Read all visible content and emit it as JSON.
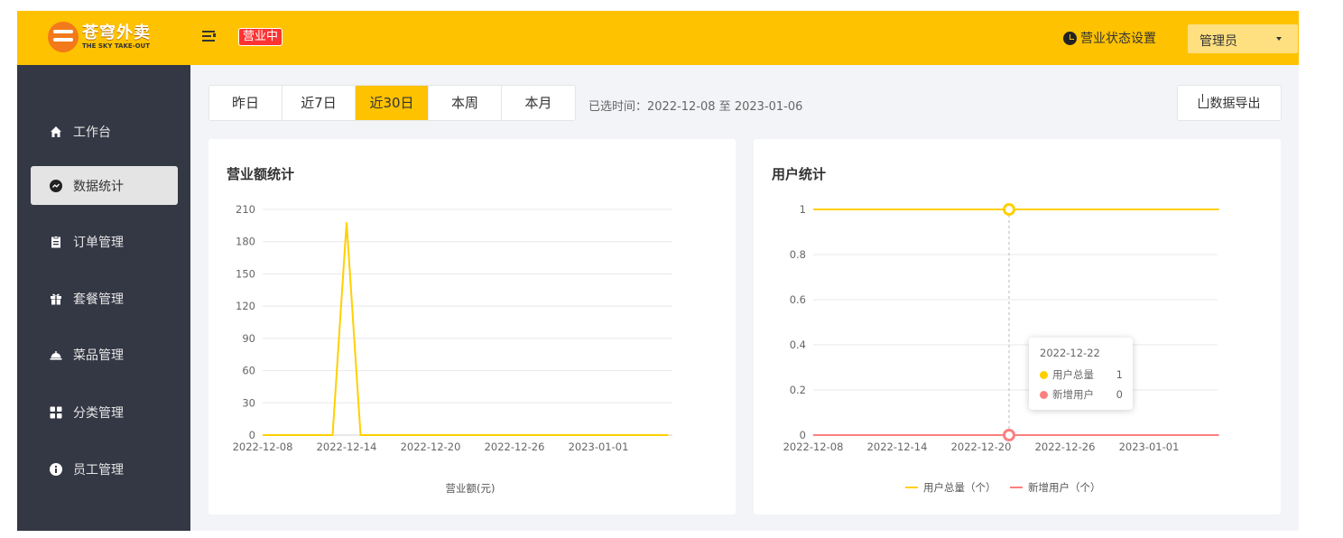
{
  "brand": {
    "name_cn": "苍穹外卖",
    "name_en": "THE SKY TAKE-OUT"
  },
  "header": {
    "status_badge": "营业中",
    "business_status_label": "营业状态设置",
    "admin_label": "管理员"
  },
  "sidebar": {
    "items": [
      {
        "label": "工作台",
        "icon": "home-icon",
        "active": false
      },
      {
        "label": "数据统计",
        "icon": "chart-icon",
        "active": true
      },
      {
        "label": "订单管理",
        "icon": "clipboard-icon",
        "active": false
      },
      {
        "label": "套餐管理",
        "icon": "gift-icon",
        "active": false
      },
      {
        "label": "菜品管理",
        "icon": "dish-icon",
        "active": false
      },
      {
        "label": "分类管理",
        "icon": "category-icon",
        "active": false
      },
      {
        "label": "员工管理",
        "icon": "employee-icon",
        "active": false
      }
    ]
  },
  "toolbar": {
    "tabs": [
      "昨日",
      "近7日",
      "近30日",
      "本周",
      "本月"
    ],
    "active_tab": "近30日",
    "date_range": "已选时间：2022-12-08 至 2023-01-06",
    "export_label": "数据导出"
  },
  "colors": {
    "accent": "#ffc200",
    "sidebar_bg": "#343744",
    "series_total": "#ffd000",
    "series_new": "#fd7f7f",
    "badge": "#fd3333"
  },
  "chart_data": [
    {
      "type": "line",
      "title": "营业额统计",
      "xlabel": "营业额(元)",
      "ylabel": "",
      "ylim": [
        0,
        210
      ],
      "yticks": [
        "0",
        "30",
        "60",
        "90",
        "120",
        "150",
        "180",
        "210"
      ],
      "xticks": [
        "2022-12-08",
        "2022-12-14",
        "2022-12-20",
        "2022-12-26",
        "2023-01-01"
      ],
      "grid": true,
      "series": [
        {
          "x": [
            "2022-12-08",
            "2022-12-09",
            "2022-12-10",
            "2022-12-11",
            "2022-12-12",
            "2022-12-13",
            "2022-12-14",
            "2022-12-15",
            "2022-12-16",
            "2022-12-17",
            "2022-12-18",
            "2022-12-19",
            "2022-12-20",
            "2022-12-21",
            "2022-12-22",
            "2022-12-23",
            "2022-12-24",
            "2022-12-25",
            "2022-12-26",
            "2022-12-27",
            "2022-12-28",
            "2022-12-29",
            "2022-12-30",
            "2022-12-31",
            "2023-01-01",
            "2023-01-02",
            "2023-01-03",
            "2023-01-04",
            "2023-01-05",
            "2023-01-06"
          ],
          "values": [
            0,
            0,
            0,
            0,
            0,
            0,
            198,
            0,
            0,
            0,
            0,
            0,
            0,
            0,
            0,
            0,
            0,
            0,
            0,
            0,
            0,
            0,
            0,
            0,
            0,
            0,
            0,
            0,
            0,
            0
          ]
        }
      ]
    },
    {
      "type": "line",
      "title": "用户统计",
      "ylim": [
        0,
        1
      ],
      "yticks": [
        "0",
        "0.2",
        "0.4",
        "0.6",
        "0.8",
        "1"
      ],
      "xticks": [
        "2022-12-08",
        "2022-12-14",
        "2022-12-20",
        "2022-12-26",
        "2023-01-01"
      ],
      "grid": true,
      "legend": "bottom-center",
      "series": [
        {
          "name": "用户总量（个）",
          "values": [
            1,
            1,
            1,
            1,
            1,
            1,
            1,
            1,
            1,
            1,
            1,
            1,
            1,
            1,
            1,
            1,
            1,
            1,
            1,
            1,
            1,
            1,
            1,
            1,
            1,
            1,
            1,
            1,
            1,
            1
          ]
        },
        {
          "name": "新增用户（个）",
          "values": [
            0,
            0,
            0,
            0,
            0,
            0,
            0,
            0,
            0,
            0,
            0,
            0,
            0,
            0,
            0,
            0,
            0,
            0,
            0,
            0,
            0,
            0,
            0,
            0,
            0,
            0,
            0,
            0,
            0,
            0
          ]
        }
      ],
      "tooltip": {
        "date": "2022-12-22",
        "rows": [
          {
            "label": "用户总量",
            "value": "1"
          },
          {
            "label": "新增用户",
            "value": "0"
          }
        ]
      }
    }
  ]
}
